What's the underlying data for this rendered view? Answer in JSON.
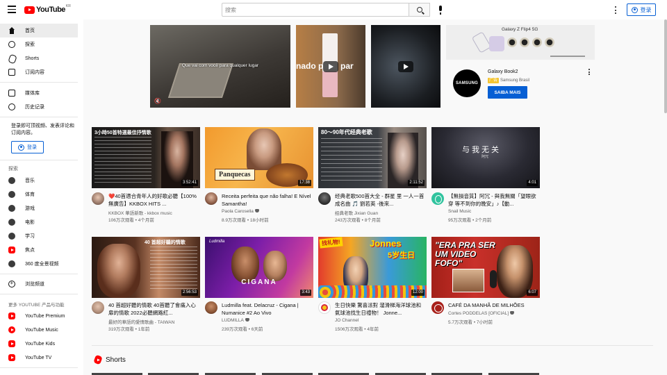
{
  "header": {
    "logo_text": "YouTube",
    "country_code": "KR",
    "search_placeholder": "搜索",
    "signin_label": "登录"
  },
  "sidebar": {
    "primary": [
      {
        "label": "首页",
        "icon": "home-icon",
        "active": true
      },
      {
        "label": "探索",
        "icon": "compass-icon"
      },
      {
        "label": "Shorts",
        "icon": "shorts-icon"
      },
      {
        "label": "订阅内容",
        "icon": "subscriptions-icon"
      }
    ],
    "library": [
      {
        "label": "媒体库",
        "icon": "library-icon"
      },
      {
        "label": "历史记录",
        "icon": "history-icon"
      }
    ],
    "signin_prompt": "登录即可顶视频、发表评论和订阅内容。",
    "signin_label": "登录",
    "explore_heading": "探索",
    "explore": [
      {
        "label": "音乐",
        "icon": "music-icon"
      },
      {
        "label": "体育",
        "icon": "trophy-icon"
      },
      {
        "label": "游戏",
        "icon": "gamepad-icon"
      },
      {
        "label": "电影",
        "icon": "film-icon"
      },
      {
        "label": "学习",
        "icon": "bulb-icon"
      },
      {
        "label": "焦点",
        "icon": "youtube-icon"
      },
      {
        "label": "360 度全景视频",
        "icon": "vr-icon"
      }
    ],
    "browse_channels": "浏览频道",
    "more_heading": "更多 YOUTUBE 产品与功能",
    "more": [
      {
        "label": "YouTube Premium",
        "icon": "youtube-premium-icon"
      },
      {
        "label": "YouTube Music",
        "icon": "youtube-music-icon"
      },
      {
        "label": "YouTube Kids",
        "icon": "youtube-kids-icon"
      },
      {
        "label": "YouTube TV",
        "icon": "youtube-tv-icon"
      }
    ]
  },
  "ad": {
    "video_caption": "Que vai com você para qualquer lugar",
    "video_b_caption": "nado para, par",
    "banner_title": "Galaxy Z Flip4 5G",
    "advertiser_logo": "SAMSUNG",
    "title": "Galaxy Book2",
    "badge": "广告",
    "advertiser": "Samsung Brasil",
    "cta": "SAIBA MAIS"
  },
  "videos": [
    {
      "title": "❤️40首適合青年人的好歌必聽【100%無廣告】KKBOX HITS ...",
      "channel": "KKBOX 華語新歌 - kkbox music",
      "meta": "106万次观看 • 4个月前",
      "duration": "3:52:41",
      "thumb_text": "3小時50首特選最佳抒情歌"
    },
    {
      "title": "Receita perfeita que não falha! E Nível Samantha!",
      "channel": "Paola Carosella",
      "verified": true,
      "meta": "8.9万次观看 • 18小时前",
      "duration": "17:38",
      "thumb_text": "Panquecas"
    },
    {
      "title": "经典老歌500首大全 - 群星 里 一人一首成名曲 🎵 劉若英 -後來...",
      "channel": "经典老歌 Jixian Guan",
      "meta": "243万次观看 • 8个月前",
      "duration": "2:11:52",
      "thumb_text": "80～90年代经典老歌"
    },
    {
      "title": "【無損音質】阿冗 - 與我無關「望眼欲穿 等不到你的晚安」♪【動...",
      "channel": "Snail Music",
      "meta": "95万次观看 • 2个月前",
      "duration": "4:01",
      "thumb_text": "与我无关",
      "thumb_sub": "阿冗"
    },
    {
      "title": "40 首超好聽的情歌 40首聽了會痛入心扉的情歌 2022必聽網路紅...",
      "channel": "最好的華語的愛情歌曲 - TAIWAN",
      "meta": "319万次观看 • 1年前",
      "duration": "2:56:53",
      "thumb_text": "40 首超好聽的情歌"
    },
    {
      "title": "Ludmilla feat. Delacruz - Cigana | Numanice #2 Ao Vivo",
      "channel": "LUDMILLA",
      "verified": true,
      "meta": "239万次观看 • 6天前",
      "duration": "3:43",
      "thumb_text": "CIGANA",
      "thumb_brand": "Ludmilla"
    },
    {
      "title": "生日快樂 驚喜派對 溜滑梯海洋球池和氣球池找生日禮物！ Jonne...",
      "channel": "JO Channel",
      "meta": "1506万次观看 • 4年前",
      "duration": "12:00",
      "thumb_text": "Jonnes",
      "thumb_sub": "5岁生日",
      "thumb_tag": "找礼物!"
    },
    {
      "title": "CAFÉ DA MANHÃ DE MILHÕES",
      "channel": "Cortes PODDELAS [OFICIAL]",
      "verified": true,
      "meta": "5.7万次观看 • 7小时前",
      "duration": "6:07",
      "thumb_text": "\"ERA PRA SER UM VIDEO FOFO\""
    }
  ],
  "shorts_heading": "Shorts",
  "colors": {
    "brand_red": "#ff0000",
    "link_blue": "#065fd4",
    "background": "#f9f9f9"
  }
}
